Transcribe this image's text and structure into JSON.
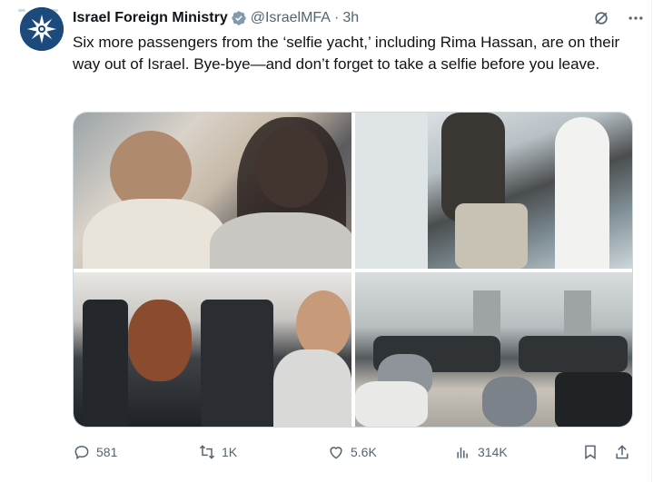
{
  "post": {
    "author_name": "Israel Foreign Ministry",
    "author_handle": "@IsraelMFA",
    "separator": "·",
    "time": "3h",
    "text": "Six more passengers from the ‘selfie yacht,’ including Rima Hassan, are on their way out of Israel. Bye-bye—and don’t forget to take a selfie before you leave."
  },
  "media": {
    "photos": [
      {
        "name": "photo-1"
      },
      {
        "name": "photo-2"
      },
      {
        "name": "photo-3"
      },
      {
        "name": "photo-4"
      }
    ]
  },
  "actions": {
    "replies": "581",
    "reposts": "1K",
    "likes": "5.6K",
    "views": "314K"
  },
  "icons": {
    "verified": "verified-badge-icon",
    "grok": "grok-icon",
    "more": "more-icon",
    "reply": "reply-icon",
    "repost": "repost-icon",
    "like": "like-icon",
    "views": "views-icon",
    "bookmark": "bookmark-icon",
    "share": "share-icon"
  },
  "colors": {
    "avatar_bg": "#1d4a7d",
    "verified": "#829aab",
    "secondary_text": "#536471",
    "primary_text": "#0f1419"
  }
}
